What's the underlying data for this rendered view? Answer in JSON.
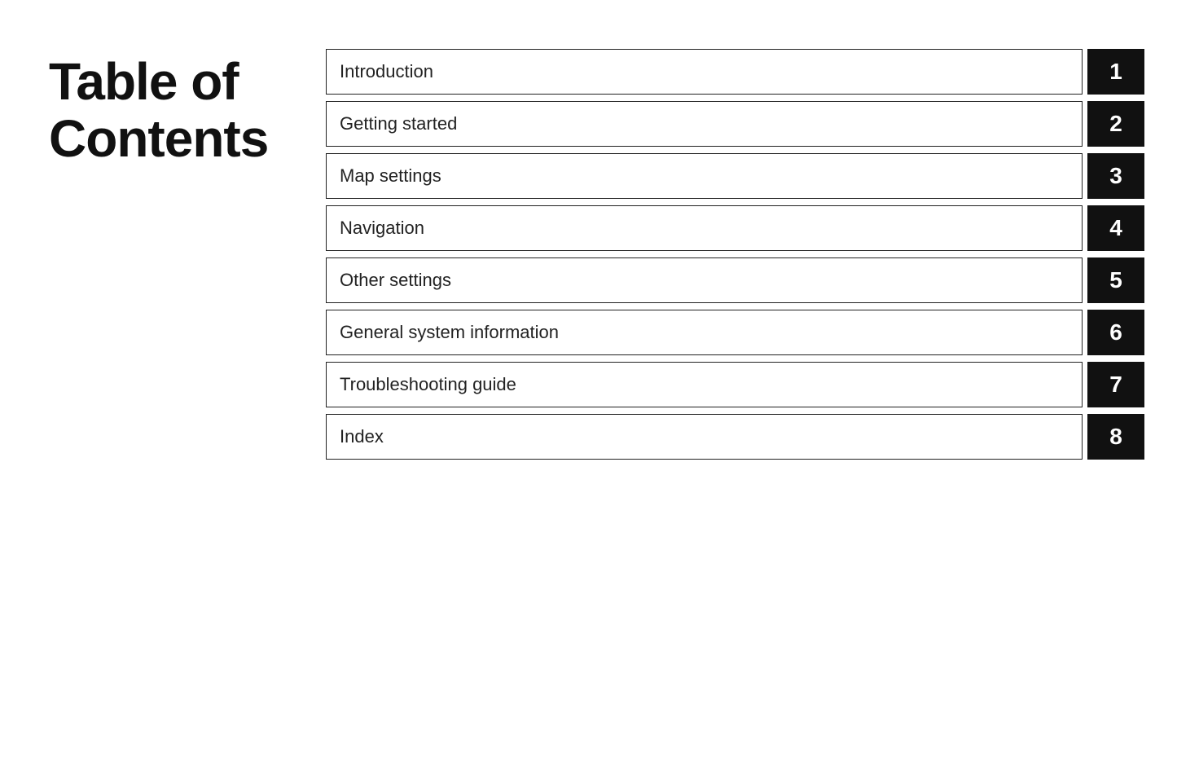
{
  "title": {
    "line1": "Table of",
    "line2": "Contents"
  },
  "entries": [
    {
      "label": "Introduction",
      "number": "1"
    },
    {
      "label": "Getting started",
      "number": "2"
    },
    {
      "label": "Map settings",
      "number": "3"
    },
    {
      "label": "Navigation",
      "number": "4"
    },
    {
      "label": "Other settings",
      "number": "5"
    },
    {
      "label": "General system information",
      "number": "6"
    },
    {
      "label": "Troubleshooting guide",
      "number": "7"
    },
    {
      "label": "Index",
      "number": "8"
    }
  ]
}
